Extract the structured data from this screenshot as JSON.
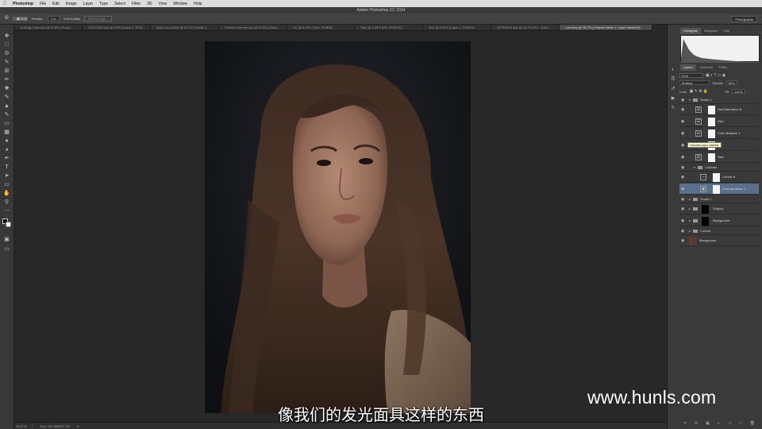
{
  "menubar": {
    "app_name": "Photoshop",
    "items": [
      "File",
      "Edit",
      "Image",
      "Layer",
      "Type",
      "Select",
      "Filter",
      "3D",
      "View",
      "Window",
      "Help"
    ]
  },
  "app_title": "Adobe Photoshop CC 2014",
  "options": {
    "feather_label": "Feather:",
    "feather_value": "0 px",
    "antialias_label": "Anti-alias",
    "refine_edge_label": "Refine Edge...",
    "workspace": "Photography"
  },
  "tabs": [
    {
      "label": "Grading-Tools.psd @ 6.25% (Group..."
    },
    {
      "label": "CF014545.psd @ 25% (Grade 2, RGB..."
    },
    {
      "label": "High-Key-Grade @ 34.2% (Grade 1,..."
    },
    {
      "label": "Outdoor-Sample.psd @ 6.25% (Grad..."
    },
    {
      "label": "OO @ 6.25% (Skin, RGB/8)..."
    },
    {
      "label": "Skin @ 8.33% (DN, RGB/16)..."
    },
    {
      "label": "Boo @ 8.33% (Layer 1, RGB/16..."
    },
    {
      "label": "CF016546.psd @ 16.7% (RA - Natur..."
    },
    {
      "label": "Low-Key @ 16.7% (Channel Mixer 1, Layer Mask/16)"
    }
  ],
  "status": {
    "zoom": "16.67%",
    "doc": "Doc: 151.9M/827.7M"
  },
  "panels": {
    "top_tabs": [
      "Histogram",
      "Navigator",
      "Info"
    ],
    "layer_tabs": [
      "Layers",
      "Channels",
      "Paths"
    ],
    "kind_label": "Kind",
    "blend_mode": "Multiply",
    "opacity_label": "Opacity:",
    "opacity_value": "62%",
    "lock_label": "Lock:",
    "fill_label": "Fill:",
    "fill_value": "100%"
  },
  "layers": [
    {
      "name": "Grade 2",
      "type": "group"
    },
    {
      "name": "Hue/Saturation 8",
      "type": "adjustment"
    },
    {
      "name": "Skin",
      "type": "adjustment"
    },
    {
      "name": "Color Balance 1",
      "type": "adjustment"
    },
    {
      "name": "",
      "type": "adjustment"
    },
    {
      "name": "Skin",
      "type": "adjustment"
    },
    {
      "name": "Contrast",
      "type": "group"
    },
    {
      "name": "Curves 8",
      "type": "adjustment"
    },
    {
      "name": "Channel Mixer 1",
      "type": "adjustment",
      "selected": true
    },
    {
      "name": "Grade 1",
      "type": "group"
    },
    {
      "name": "Subject",
      "type": "masked-group"
    },
    {
      "name": "Background",
      "type": "masked-group"
    },
    {
      "name": "Correct",
      "type": "group"
    },
    {
      "name": "Background",
      "type": "pixel"
    }
  ],
  "tooltip": "Indicates layer visibility",
  "subtitle": "像我们的发光面具这样的东西",
  "watermark": "www.hunls.com"
}
